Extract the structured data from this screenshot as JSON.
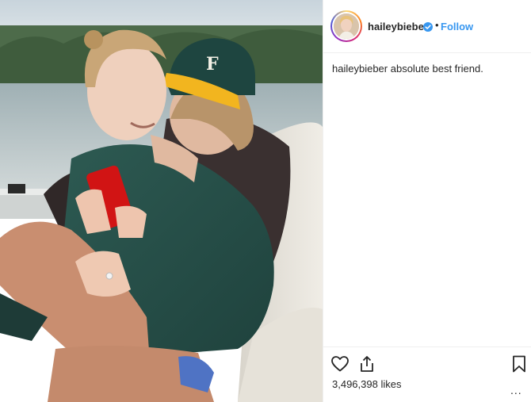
{
  "post": {
    "username": "haileybieber",
    "verified": true,
    "follow_label": "Follow",
    "dot": "•",
    "caption_user": "haileybieber",
    "caption_text": "absolute best friend.",
    "likes": "3,496,398 likes",
    "more": "..."
  },
  "icons": {
    "heart": "heart-icon",
    "share": "share-icon",
    "save": "bookmark-icon",
    "verified": "verified-badge-icon",
    "more": "more-options-icon"
  },
  "colors": {
    "link": "#3897f0",
    "text": "#262626",
    "border": "#efefef"
  }
}
